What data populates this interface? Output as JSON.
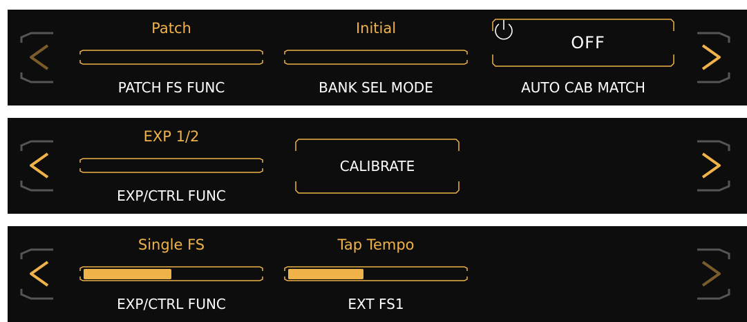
{
  "panels": [
    {
      "params": [
        {
          "value": "Patch",
          "label": "PATCH FS FUNC"
        },
        {
          "value": "Initial",
          "label": "BANK SEL MODE"
        }
      ],
      "toggle": {
        "state": "OFF",
        "label": "AUTO CAB MATCH",
        "icon": "power-icon"
      },
      "nav": {
        "left": "chevron-left-icon",
        "right": "chevron-right-icon"
      }
    },
    {
      "params": [
        {
          "value": "EXP 1/2",
          "label": "EXP/CTRL FUNC"
        }
      ],
      "button": {
        "label": "CALIBRATE"
      },
      "nav": {
        "left": "chevron-left-icon",
        "right": "chevron-right-icon"
      }
    },
    {
      "params": [
        {
          "value": "Single FS",
          "label": "EXP/CTRL FUNC",
          "level": 0.5
        },
        {
          "value": "Tap Tempo",
          "label": "EXT FS1",
          "level": 0.43
        }
      ],
      "nav": {
        "left": "chevron-left-icon",
        "right": "chevron-right-icon"
      }
    }
  ],
  "colors": {
    "accent": "#f0b34a",
    "dim_accent": "#7a5c2a",
    "frame": "#555555",
    "background": "#0d0d0d",
    "text": "#ffffff"
  }
}
